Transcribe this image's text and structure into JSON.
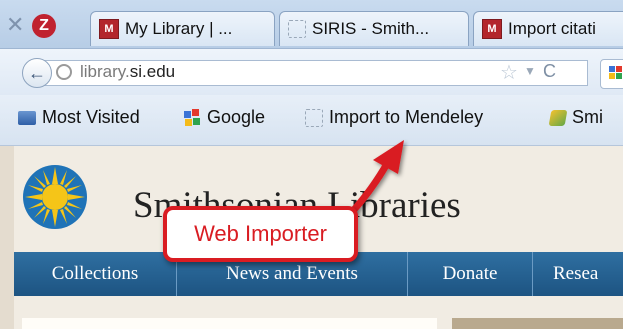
{
  "browser": {
    "tabs": [
      {
        "label": "My Library | ..."
      },
      {
        "label": "SIRIS - Smith..."
      },
      {
        "label": "Import citati"
      }
    ],
    "url_prefix": "library.",
    "url_domain": "si.edu",
    "bookmarks": [
      {
        "label": "Most Visited"
      },
      {
        "label": "Google"
      },
      {
        "label": "Import to Mendeley"
      },
      {
        "label": "Smi"
      }
    ]
  },
  "page": {
    "site_title": "Smithsonian Libraries",
    "menu": [
      {
        "label": "Collections"
      },
      {
        "label": "News and Events"
      },
      {
        "label": "Donate"
      },
      {
        "label": "Resea"
      }
    ]
  },
  "callout": {
    "label": "Web Importer"
  },
  "colors": {
    "callout_red": "#d91c22",
    "menu_blue": "#1d5482",
    "tab_bar": "#c9dbef",
    "page_bg": "#f1ece3",
    "logo_yellow": "#f5c518",
    "logo_blue": "#1f73b7"
  },
  "icons": {
    "back": "back-arrow-icon",
    "globe": "globe-icon",
    "star": "bookmark-star-icon",
    "reload": "reload-icon",
    "google": "google-icon",
    "mendeley": "mendeley-icon"
  }
}
